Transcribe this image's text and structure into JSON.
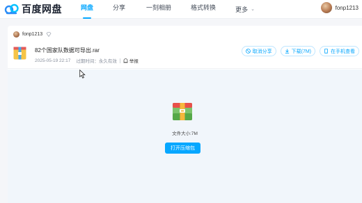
{
  "header": {
    "logo_text": "百度网盘",
    "nav": [
      {
        "label": "网盘",
        "active": true
      },
      {
        "label": "分享",
        "active": false
      },
      {
        "label": "一刻相册",
        "active": false
      },
      {
        "label": "格式转换",
        "active": false
      },
      {
        "label": "更多",
        "active": false
      }
    ],
    "username": "fonp1213"
  },
  "share": {
    "sharer_name": "fonp1213",
    "file_name": "82个国家队数据可导出.rar",
    "date": "2025-05-19 22:17",
    "expiry_label": "过期时间：永久有效",
    "report_label": "举报",
    "actions": {
      "cancel": "取消分享",
      "download": "下载(7M)",
      "phone": "在手机查看"
    }
  },
  "preview": {
    "size_text": "文件大小:7M",
    "open_label": "打开压缩包"
  },
  "colors": {
    "accent": "#06a7ff",
    "preview_bg": "#f1f6fb"
  }
}
